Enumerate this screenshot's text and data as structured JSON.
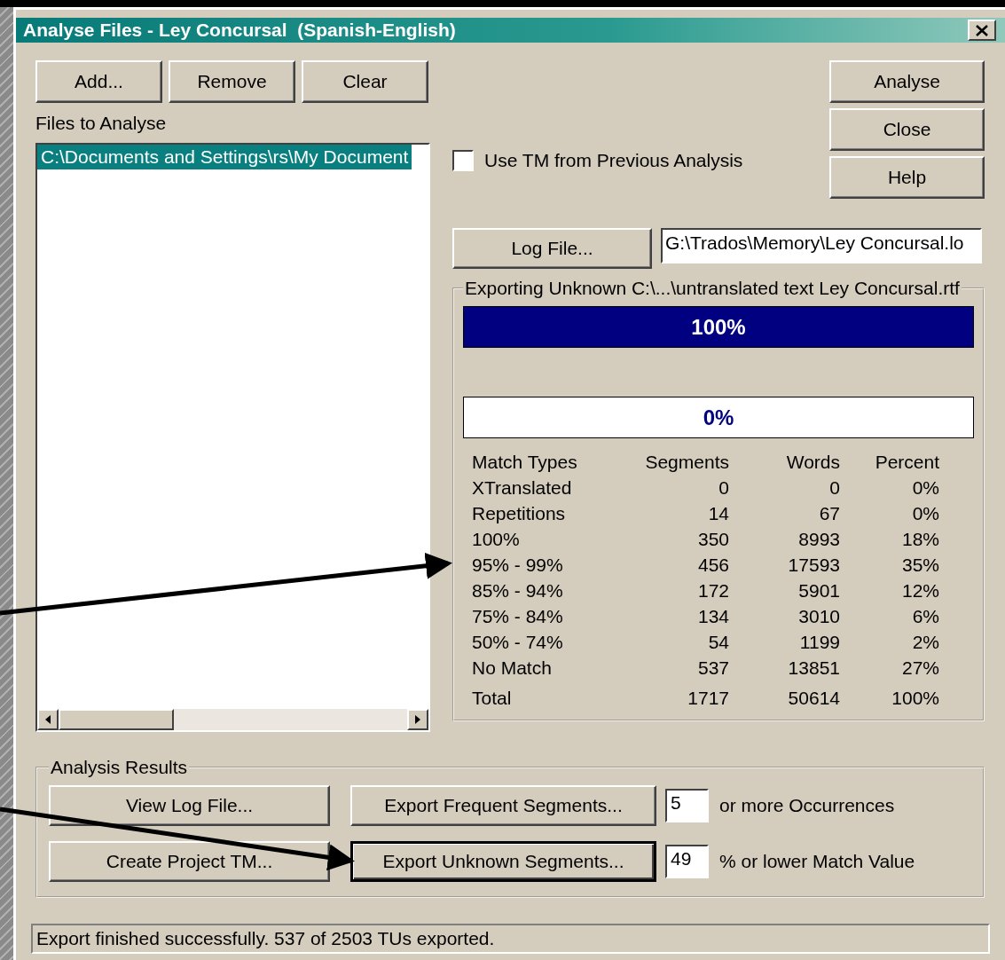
{
  "window": {
    "title": "Analyse Files - Ley Concursal  (Spanish-English)"
  },
  "file_buttons": [
    "Add...",
    "Remove",
    "Clear"
  ],
  "files_label": "Files to Analyse",
  "files": [
    {
      "path": "C:\\Documents and Settings\\rs\\My Document",
      "selected": true
    }
  ],
  "use_previous_tm": {
    "label": "Use TM from Previous Analysis",
    "checked": false
  },
  "action_buttons": [
    "Analyse",
    "Close",
    "Help"
  ],
  "log_file": {
    "button": "Log File...",
    "value": "G:\\Trados\\Memory\\Ley Concursal.lo"
  },
  "progress_group": {
    "legend": "Exporting Unknown C:\\...\\untranslated text Ley Concursal.rtf",
    "bars": [
      {
        "label": "100%",
        "level": 1
      },
      {
        "label": "0%",
        "level": 0
      }
    ],
    "table": {
      "columns": [
        "Match Types",
        "Segments",
        "Words",
        "Percent"
      ],
      "rows": [
        [
          "XTranslated",
          "0",
          "0",
          "0%"
        ],
        [
          "Repetitions",
          "14",
          "67",
          "0%"
        ],
        [
          "100%",
          "350",
          "8993",
          "18%"
        ],
        [
          "95% - 99%",
          "456",
          "17593",
          "35%"
        ],
        [
          "85% - 94%",
          "172",
          "5901",
          "12%"
        ],
        [
          "75% - 84%",
          "134",
          "3010",
          "6%"
        ],
        [
          "50% - 74%",
          "54",
          "1199",
          "2%"
        ],
        [
          "No Match",
          "537",
          "13851",
          "27%"
        ]
      ],
      "total": [
        "Total",
        "1717",
        "50614",
        "100%"
      ]
    }
  },
  "analysis_results": {
    "legend": "Analysis Results",
    "rows": [
      {
        "buttons": [
          {
            "label": "View Log File...",
            "focused": false
          },
          {
            "label": "Export Frequent Segments...",
            "focused": false
          }
        ],
        "value": "5",
        "suffix": "or more Occurrences"
      },
      {
        "buttons": [
          {
            "label": "Create Project TM...",
            "focused": false
          },
          {
            "label": "Export Unknown Segments...",
            "focused": true
          }
        ],
        "value": "49",
        "suffix": "% or lower Match Value"
      }
    ]
  },
  "status_bar": "Export finished successfully. 537 of 2503 TUs exported."
}
